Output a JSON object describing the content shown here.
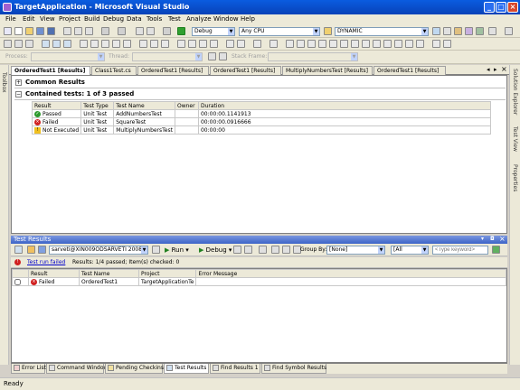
{
  "window": {
    "title": "TargetApplication - Microsoft Visual Studio",
    "min_glyph": "_",
    "max_glyph": "□",
    "close_glyph": "×"
  },
  "menu": [
    "File",
    "Edit",
    "View",
    "Project",
    "Build",
    "Debug",
    "Data",
    "Tools",
    "Test",
    "Analyze",
    "Window",
    "Help"
  ],
  "toolbar": {
    "config": "Debug",
    "platform": "Any CPU",
    "find_combo": "DYNAMIC"
  },
  "debug_location": {
    "process_label": "Process:",
    "thread_label": "Thread:",
    "stackframe_label": "Stack Frame:"
  },
  "side": {
    "left": [
      "Toolbox"
    ],
    "right": [
      "Solution Explorer",
      "Test View",
      "Properties"
    ]
  },
  "doc_tabs": [
    "OrderedTest1 [Results]",
    "Class1Test.cs",
    "OrderedTest1 [Results]",
    "OrderedTest1 [Results]",
    "MultiplyNumbersTest [Results]",
    "OrderedTest1 [Results]"
  ],
  "doc": {
    "common_results_label": "Common Results",
    "contained_tests_label": "Contained tests: 1 of 3 passed",
    "expand_glyph": "+",
    "collapse_glyph": "−",
    "columns": [
      "Result",
      "Test Type",
      "Test Name",
      "Owner",
      "Duration"
    ],
    "rows": [
      {
        "result": "Passed",
        "status": "pass",
        "type": "Unit Test",
        "name": "AddNumbersTest",
        "owner": "",
        "duration": "00:00:00.1141913"
      },
      {
        "result": "Failed",
        "status": "fail",
        "type": "Unit Test",
        "name": "SquareTest",
        "owner": "",
        "duration": "00:00:00.0916666"
      },
      {
        "result": "Not Executed",
        "status": "warn",
        "type": "Unit Test",
        "name": "MultiplyNumbersTest",
        "owner": "",
        "duration": "00:00:00"
      }
    ]
  },
  "test_results": {
    "title": "Test Results",
    "run_combo": "sarveti@XIN009ODSARVETI 2008-08",
    "run_button": "Run",
    "debug_button": "Debug",
    "group_by_label": "Group By:",
    "group_by_value": "[None]",
    "columns_combo": "[All Columns]",
    "keyword_placeholder": "<Type keyword>",
    "status_link": "Test run failed",
    "status_text": "Results: 1/4 passed;  Item(s) checked: 0",
    "list_columns": [
      "Result",
      "Test Name",
      "Project",
      "Error Message"
    ],
    "rows": [
      {
        "result": "Failed",
        "name": "OrderedTest1",
        "project": "TargetApplicationTe",
        "error": ""
      }
    ]
  },
  "bottom_tabs": [
    "Error List",
    "Command Window",
    "Pending Checkins",
    "Test Results",
    "Find Results 1",
    "Find Symbol Results"
  ],
  "status": {
    "text": "Ready"
  },
  "colors": {
    "title_bar": "#0a5ce0",
    "passed": "#2e9a2e",
    "failed": "#d02020",
    "not_executed": "#f0c020"
  }
}
